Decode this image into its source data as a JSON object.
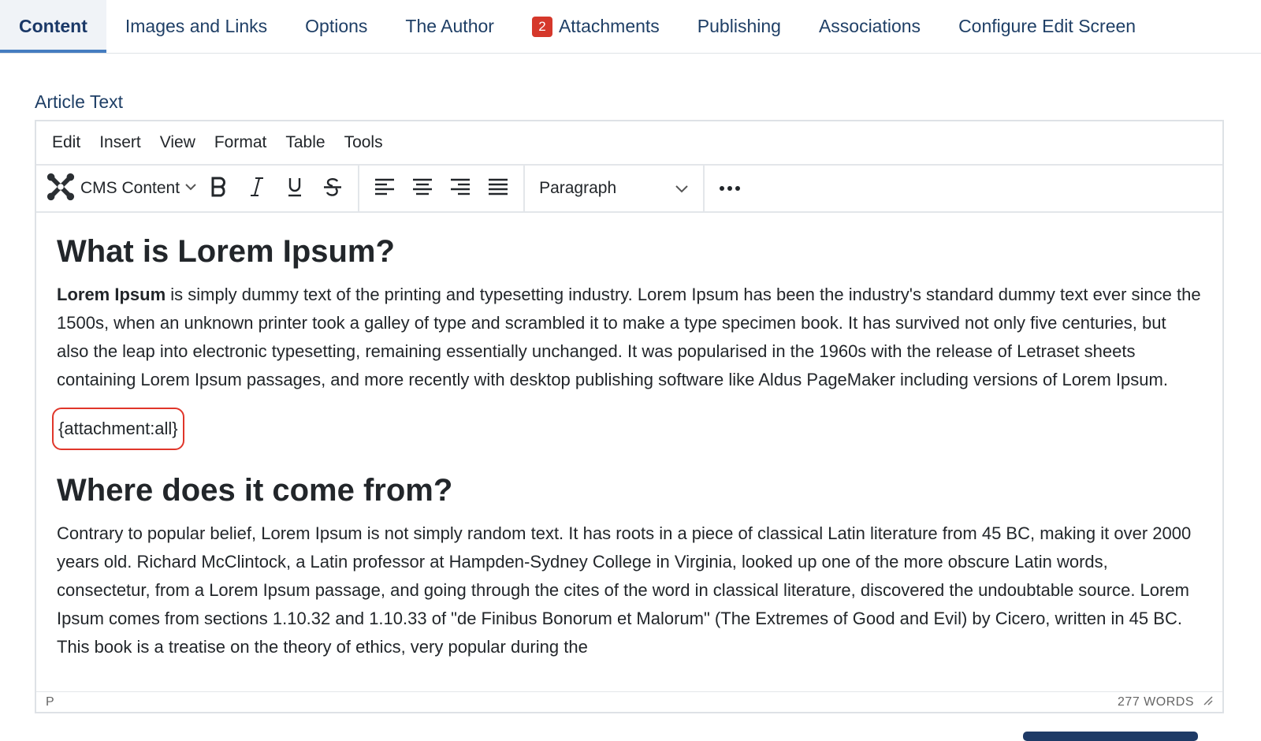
{
  "tabs": [
    {
      "label": "Content",
      "active": true
    },
    {
      "label": "Images and Links"
    },
    {
      "label": "Options"
    },
    {
      "label": "The Author"
    },
    {
      "label": "Attachments",
      "badge": "2"
    },
    {
      "label": "Publishing"
    },
    {
      "label": "Associations"
    },
    {
      "label": "Configure Edit Screen"
    }
  ],
  "field_label": "Article Text",
  "editor": {
    "menu": [
      "Edit",
      "Insert",
      "View",
      "Format",
      "Table",
      "Tools"
    ],
    "toolbar": {
      "cms_content_label": "CMS Content",
      "format_select_value": "Paragraph",
      "icons": [
        "joomla-icon",
        "bold-icon",
        "italic-icon",
        "underline-icon",
        "strikethrough-icon",
        "align-left-icon",
        "align-center-icon",
        "align-right-icon",
        "justify-icon",
        "more-icon"
      ]
    },
    "content": {
      "heading1": "What is Lorem Ipsum?",
      "para1_bold": "Lorem Ipsum",
      "para1_rest": " is simply dummy text of the printing and typesetting industry. Lorem Ipsum has been the industry's standard dummy text ever since the 1500s, when an unknown printer took a galley of type and scrambled it to make a type specimen book. It has survived not only five centuries, but also the leap into electronic typesetting, remaining essentially unchanged. It was popularised in the 1960s with the release of Letraset sheets containing Lorem Ipsum passages, and more recently with desktop publishing software like Aldus PageMaker including versions of Lorem Ipsum.",
      "shortcode": "{attachment:all}",
      "heading2": "Where does it come from?",
      "para2": "Contrary to popular belief, Lorem Ipsum is not simply random text. It has roots in a piece of classical Latin literature from 45 BC, making it over 2000 years old. Richard McClintock, a Latin professor at Hampden-Sydney College in Virginia, looked up one of the more obscure Latin words, consectetur, from a Lorem Ipsum passage, and going through the cites of the word in classical literature, discovered the undoubtable source. Lorem Ipsum comes from sections 1.10.32 and 1.10.33 of \"de Finibus Bonorum et Malorum\" (The Extremes of Good and Evil) by Cicero, written in 45 BC. This book is a treatise on the theory of ethics, very popular during the"
    },
    "status": {
      "path": "P",
      "word_count": "277 WORDS"
    }
  },
  "colors": {
    "accent": "#457cc0",
    "tab_text": "#1f3f66",
    "badge": "#d5382b",
    "highlight": "#e0362a"
  }
}
